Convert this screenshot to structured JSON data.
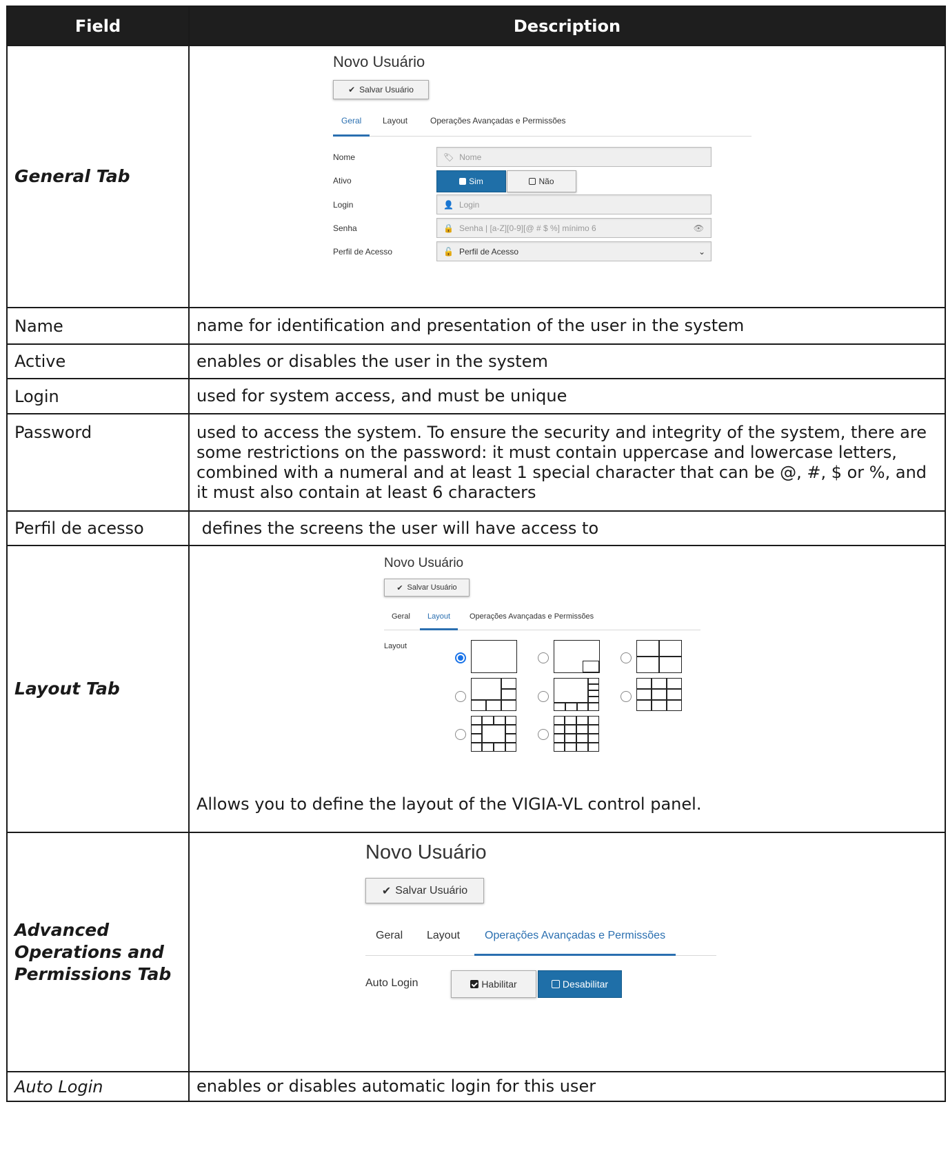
{
  "table": {
    "header": {
      "field": "Field",
      "description": "Description"
    },
    "rows": {
      "general_tab": {
        "field": "General Tab"
      },
      "name": {
        "field": "Name",
        "description": "name for identification and presentation of the user in the system"
      },
      "active": {
        "field": "Active",
        "description": "enables or disables the user in the system"
      },
      "login": {
        "field": "Login",
        "description": "used for system access, and must be unique"
      },
      "password": {
        "field": "Password",
        "description": "used to access the system. To ensure the security and integrity of the system, there are some restrictions on the password: it must contain uppercase and lowercase letters, combined with a numeral and at least 1 special character that can be @, #, $ or %, and it must also contain at least 6 characters"
      },
      "profile": {
        "field": "Perfil de acesso",
        "description": " defines the screens the user will have access to"
      },
      "layout_tab": {
        "field": "Layout Tab",
        "description": "Allows you to define the layout of the VIGIA-VL control panel."
      },
      "advanced_tab": {
        "field": "Advanced Operations and Permissions Tab"
      },
      "auto_login": {
        "field": "Auto Login",
        "description": "enables or disables automatic login for this user"
      }
    }
  },
  "screens": {
    "general": {
      "title": "Novo Usuário",
      "save_button": "Salvar Usuário",
      "tabs": [
        "Geral",
        "Layout",
        "Operações Avançadas e Permissões"
      ],
      "active_tab": "Geral",
      "fields": {
        "nome_label": "Nome",
        "nome_placeholder": "Nome",
        "ativo_label": "Ativo",
        "ativo_yes": "Sim",
        "ativo_no": "Não",
        "login_label": "Login",
        "login_placeholder": "Login",
        "senha_label": "Senha",
        "senha_placeholder": "Senha | [a-Z][0-9][@ # $ %] mínimo 6",
        "perfil_label": "Perfil de Acesso",
        "perfil_value": "Perfil de Acesso"
      }
    },
    "layout": {
      "title": "Novo Usuário",
      "save_button": "Salvar Usuário",
      "tabs": [
        "Geral",
        "Layout",
        "Operações Avançadas e Permissões"
      ],
      "active_tab": "Layout",
      "layout_label": "Layout",
      "layout_options": [
        "single",
        "picture-in-picture",
        "2x2",
        "1+7",
        "1+9",
        "3x3",
        "1+12",
        "4x4"
      ],
      "selected_layout": "single"
    },
    "advanced": {
      "title": "Novo Usuário",
      "save_button": "Salvar Usuário",
      "tabs": [
        "Geral",
        "Layout",
        "Operações Avançadas e Permissões"
      ],
      "active_tab": "Operações Avançadas e Permissões",
      "auto_login_label": "Auto Login",
      "enable": "Habilitar",
      "disable": "Desabilitar",
      "selected": "Desabilitar"
    }
  },
  "colors": {
    "accent": "#1f6fa8",
    "header_bg": "#1e1e1e",
    "radio": "#1a73e8"
  }
}
